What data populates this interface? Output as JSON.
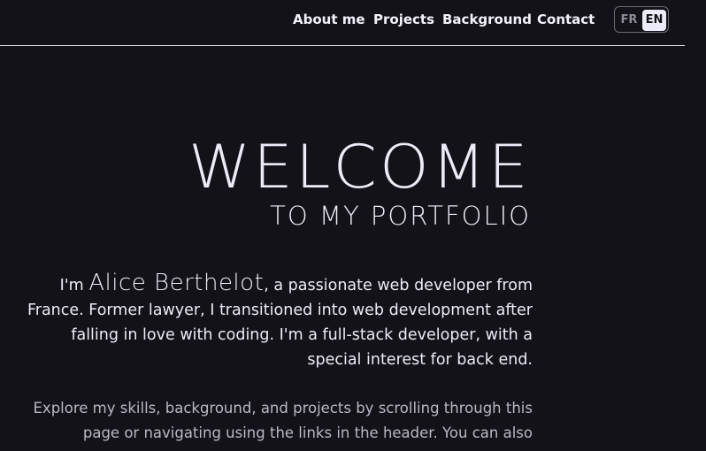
{
  "nav": {
    "links": [
      {
        "label": "About me"
      },
      {
        "label": "Projects"
      },
      {
        "label": "Background"
      },
      {
        "label": "Contact"
      }
    ],
    "languages": {
      "fr": "FR",
      "en": "EN",
      "active": "EN"
    }
  },
  "hero": {
    "title": "WELCOME",
    "subtitle": "TO MY PORTFOLIO"
  },
  "intro": {
    "prefix": "I'm ",
    "name": "Alice Berthelot",
    "rest": ", a passionate web developer from France. Former lawyer, I transitioned into web development after falling in love with coding. I'm a full-stack developer, with a special interest for back end."
  },
  "explore": {
    "text": "Explore my skills, background, and projects by scrolling through this page or navigating using the links in the header. You can also change"
  },
  "colors": {
    "background": "#131218",
    "text": "#ecebf7",
    "muted_text": "#b9b8c6",
    "divider": "#d9d8e6"
  }
}
